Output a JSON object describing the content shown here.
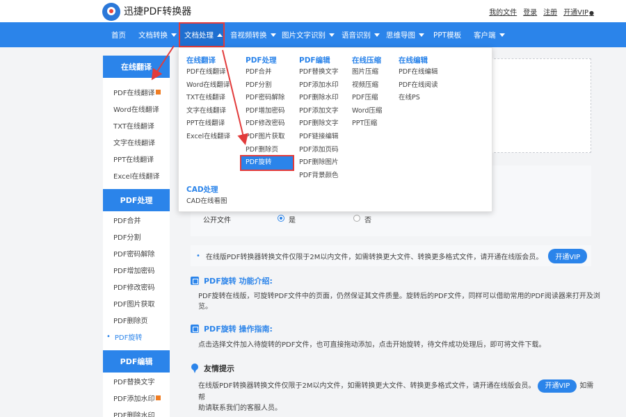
{
  "brand": {
    "name": "迅捷PDF转换器"
  },
  "top_links": [
    "我的文件",
    "登录",
    "注册",
    "开通VIP"
  ],
  "nav": [
    {
      "label": "首页",
      "caret": false
    },
    {
      "label": "文档转换",
      "caret": true
    },
    {
      "label": "文档处理",
      "caret": true,
      "active": true
    },
    {
      "label": "音视频转换",
      "caret": true
    },
    {
      "label": "图片文字识别",
      "caret": true
    },
    {
      "label": "语音识别",
      "caret": true
    },
    {
      "label": "思维导图",
      "caret": true
    },
    {
      "label": "PPT模板",
      "caret": false
    },
    {
      "label": "客户端",
      "caret": true
    }
  ],
  "sidebar": {
    "sections": [
      {
        "title": "在线翻译",
        "items": [
          "PDF在线翻译",
          "Word在线翻译",
          "TXT在线翻译",
          "文字在线翻译",
          "PPT在线翻译",
          "Excel在线翻译"
        ]
      },
      {
        "title": "PDF处理",
        "items": [
          "PDF合并",
          "PDF分割",
          "PDF密码解除",
          "PDF增加密码",
          "PDF修改密码",
          "PDF图片获取",
          "PDF删除页",
          "PDF旋转"
        ]
      },
      {
        "title": "PDF编辑",
        "items": [
          "PDF替换文字",
          "PDF添加水印",
          "PDF删除水印"
        ]
      }
    ],
    "current": "PDF旋转"
  },
  "dropdown": {
    "columns": [
      {
        "title": "在线翻译",
        "items": [
          "PDF在线翻译",
          "Word在线翻译",
          "TXT在线翻译",
          "文字在线翻译",
          "PPT在线翻译",
          "Excel在线翻译"
        ]
      },
      {
        "title": "PDF处理",
        "items": [
          "PDF合并",
          "PDF分割",
          "PDF密码解除",
          "PDF增加密码",
          "PDF修改密码",
          "PDF图片获取",
          "PDF删除页",
          "PDF旋转"
        ]
      },
      {
        "title": "PDF编辑",
        "items": [
          "PDF替换文字",
          "PDF添加水印",
          "PDF删除水印",
          "PDF添加文字",
          "PDF删除文字",
          "PDF链接编辑",
          "PDF添加页码",
          "PDF删除图片",
          "PDF背景颜色"
        ]
      },
      {
        "title": "在线压缩",
        "items": [
          "图片压缩",
          "视频压缩",
          "PDF压缩",
          "Word压缩",
          "PPT压缩"
        ]
      },
      {
        "title": "在线编辑",
        "items": [
          "PDF在线编辑",
          "PDF在线阅读",
          "在线PS"
        ]
      }
    ],
    "cad": {
      "title": "CAD处理",
      "items": [
        "CAD在线看图"
      ]
    },
    "highlighted": "PDF旋转"
  },
  "settings": {
    "public_label": "公开文件",
    "yes": "是",
    "no": "否",
    "selected": "是"
  },
  "notice": {
    "text": "在线版PDF转换器转换文件仅限于2M以内文件，如需转换更大文件、转换更多格式文件，请开通在线版会员。",
    "button": "开通VIP"
  },
  "intro": {
    "title": "PDF旋转 功能介绍:",
    "text": "PDF旋转在线版，可旋转PDF文件中的页面，仍然保证其文件质量。旋转后的PDF文件，同样可以借助常用的PDF阅读器来打开及浏览。"
  },
  "guide": {
    "title": "PDF旋转 操作指南:",
    "text": "点击选择文件加入待旋转的PDF文件，也可直接拖动添加，点击开始旋转，待文件成功处理后，即可将文件下载。"
  },
  "tips": {
    "title": "友情提示",
    "text_before": "在线版PDF转换器转换文件仅限于2M以内文件，如需转换更大文件、转换更多格式文件，请开通在线版会员。",
    "button": "开通VIP",
    "text_after_1": "如需帮",
    "text_after_2": "助请联系我们的客服人员。"
  },
  "colors": {
    "primary": "#2b84ea",
    "highlight_border": "#e23b3b",
    "accent_orange": "#f07d23"
  }
}
